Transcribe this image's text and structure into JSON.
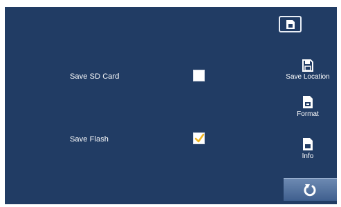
{
  "storage": {
    "sd_card": {
      "label": "Save SD Card",
      "checked": false
    },
    "flash": {
      "label": "Save Flash",
      "checked": true
    }
  },
  "toolbar": {
    "top_icon": "storage-card-icon",
    "save_location": {
      "label": "Save Location",
      "icon": "floppy-disk-icon"
    },
    "format": {
      "label": "Format",
      "icon": "sd-card-format-icon"
    },
    "info": {
      "label": "Info",
      "icon": "sd-card-info-icon"
    },
    "back": {
      "icon": "return-arrow-icon"
    }
  },
  "colors": {
    "background": "#213c64",
    "check": "#f0b41e",
    "back_button": "#5a78a4"
  }
}
